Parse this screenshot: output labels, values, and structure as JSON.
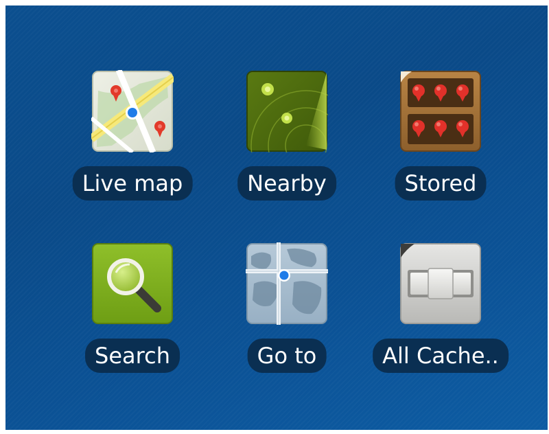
{
  "launcher": {
    "items": [
      {
        "label": "Live map",
        "icon": "live-map-icon"
      },
      {
        "label": "Nearby",
        "icon": "nearby-radar-icon"
      },
      {
        "label": "Stored",
        "icon": "stored-shelf-icon"
      },
      {
        "label": "Search",
        "icon": "search-magnifier-icon"
      },
      {
        "label": "Go to",
        "icon": "goto-globe-icon"
      },
      {
        "label": "All Cache..",
        "icon": "all-caches-box-icon"
      }
    ]
  },
  "colors": {
    "background": "#0b4f8f",
    "label_background": "#0a2f52",
    "label_text": "#ffffff"
  }
}
